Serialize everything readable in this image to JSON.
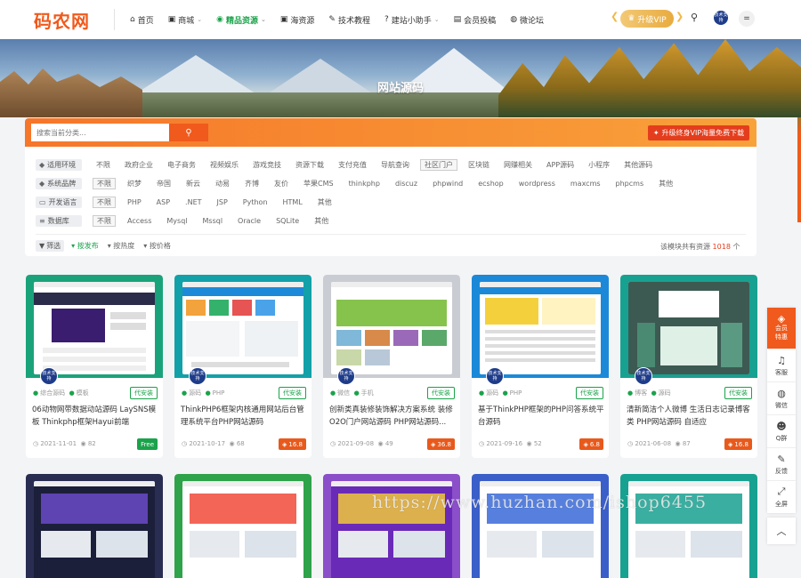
{
  "header": {
    "logo": "码农网",
    "nav": [
      {
        "label": "首页",
        "icon": "home-icon",
        "glyph": "⌂",
        "caret": false,
        "active": false
      },
      {
        "label": "商城",
        "icon": "shop-icon",
        "glyph": "▣",
        "caret": true,
        "active": false
      },
      {
        "label": "精品资源",
        "icon": "globe-icon",
        "glyph": "◉",
        "caret": true,
        "active": true
      },
      {
        "label": "海资源",
        "icon": "shop-icon",
        "glyph": "▣",
        "caret": false,
        "active": false
      },
      {
        "label": "技术教程",
        "icon": "ruler-icon",
        "glyph": "✎",
        "caret": false,
        "active": false
      },
      {
        "label": "建站小助手",
        "icon": "question-icon",
        "glyph": "?",
        "caret": true,
        "active": false
      },
      {
        "label": "会员投稿",
        "icon": "article-icon",
        "glyph": "▤",
        "caret": false,
        "active": false
      },
      {
        "label": "微论坛",
        "icon": "chat-icon",
        "glyph": "◍",
        "caret": false,
        "active": false
      }
    ],
    "vip_label": "升级VIP",
    "avatar_text": "技术支持",
    "menu_glyph": "="
  },
  "banner": {
    "title": "网站源码"
  },
  "filter": {
    "search_placeholder": "搜索当前分类...",
    "upgrade_label": "升级终身VIP海量免费下载",
    "rows": [
      {
        "tag": "适用环境",
        "icon": "tag-icon",
        "options": [
          "不限",
          "政府企业",
          "电子商务",
          "视频娱乐",
          "游戏竞技",
          "资源下载",
          "支付充值",
          "导航查询",
          "社区门户",
          "区块链",
          "网赚相关",
          "APP源码",
          "小程序",
          "其他源码"
        ],
        "selected": 8
      },
      {
        "tag": "系统品牌",
        "icon": "tag-icon",
        "options": [
          "不限",
          "织梦",
          "帝国",
          "新云",
          "动易",
          "齐博",
          "友价",
          "苹果CMS",
          "thinkphp",
          "discuz",
          "phpwind",
          "ecshop",
          "wordpress",
          "maxcms",
          "phpcms",
          "其他"
        ],
        "selected": 0
      },
      {
        "tag": "开发语言",
        "icon": "folder-icon",
        "options": [
          "不限",
          "PHP",
          "ASP",
          ".NET",
          "JSP",
          "Python",
          "HTML",
          "其他"
        ],
        "selected": 0
      },
      {
        "tag": "数据库",
        "icon": "database-icon",
        "options": [
          "不限",
          "Access",
          "Mysql",
          "Mssql",
          "Oracle",
          "SQLite",
          "其他"
        ],
        "selected": 0
      }
    ],
    "sort": {
      "tag": "筛选",
      "items": [
        "按发布",
        "按热度",
        "按价格"
      ],
      "active": 0
    },
    "count_prefix": "该模块共有资源 ",
    "count_value": "1018",
    "count_suffix": " 个"
  },
  "cards": [
    {
      "cat1": "综合源码",
      "cat2": "模板",
      "service": "代安装",
      "title": "06动物网带数据动站源码 LaySNS模板 Thinkphp框架Hayui前端",
      "date": "2021-11-01",
      "views": "82",
      "price": "Free",
      "free": true,
      "color": "#1aa37a",
      "badge": "技术支持"
    },
    {
      "cat1": "源码",
      "cat2": "PHP",
      "service": "代安装",
      "title": "ThinkPHP6框架内核通用网站后台管理系统平台PHP网站源码",
      "date": "2021-10-17",
      "views": "68",
      "price": "16.8",
      "free": false,
      "color": "#12a1a8",
      "badge": "技术支持"
    },
    {
      "cat1": "微信",
      "cat2": "手机",
      "service": "代安装",
      "title": "创新类真装修装饰解决方案系统 装修O2O门户网站源码 PHP网站源码...",
      "date": "2021-09-08",
      "views": "49",
      "price": "36.8",
      "free": false,
      "color": "#c9ccd2",
      "badge": "技术支持"
    },
    {
      "cat1": "源码",
      "cat2": "PHP",
      "service": "代安装",
      "title": "基于ThinkPHP框架的PHP问答系统平台源码",
      "date": "2021-09-16",
      "views": "52",
      "price": "6.8",
      "free": false,
      "color": "#1c89d8",
      "badge": "技术支持"
    },
    {
      "cat1": "博客",
      "cat2": "源码",
      "service": "代安装",
      "title": "清新简洁个人微博 生活日志记录博客类 PHP网站源码 自适应",
      "date": "2021-06-08",
      "views": "87",
      "price": "16.8",
      "free": false,
      "color": "#17a191",
      "badge": "技术支持"
    }
  ],
  "row2_colors": [
    "#2a2d52",
    "#2ea34a",
    "#8a4fc9",
    "#3a5fc9",
    "#17a191"
  ],
  "side": {
    "vip": [
      "会员",
      "特惠"
    ],
    "items": [
      {
        "label": "客服",
        "icon": "headset-icon",
        "glyph": "♫"
      },
      {
        "label": "微信",
        "icon": "wechat-icon",
        "glyph": "◍"
      },
      {
        "label": "Q群",
        "icon": "group-icon",
        "glyph": "☻"
      },
      {
        "label": "反馈",
        "icon": "edit-icon",
        "glyph": "✎"
      },
      {
        "label": "全屏",
        "icon": "fullscreen-icon",
        "glyph": "⤢"
      }
    ],
    "top_glyph": "︿"
  },
  "watermark": "https://www.huzhan.com/ishop6455"
}
